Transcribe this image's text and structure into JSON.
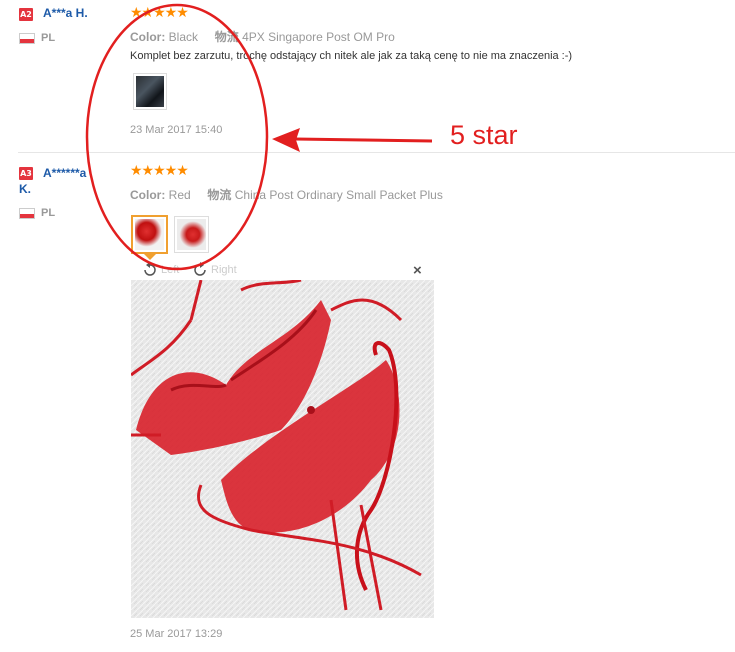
{
  "reviews": [
    {
      "badge": "A2",
      "name": "A***a H.",
      "country": "PL",
      "stars": "★★★★★",
      "color_label": "Color:",
      "color_value": "Black",
      "shipping_label": "物流",
      "shipping_value": "4PX Singapore Post OM Pro",
      "text": "Komplet bez zarzutu, trochę odstający ch nitek ale jak za taką cenę to nie ma znaczenia :-)",
      "date": "23 Mar 2017 15:40"
    },
    {
      "badge": "A3",
      "name_line1": "A******a",
      "name_line2": "K.",
      "country": "PL",
      "stars": "★★★★★",
      "color_label": "Color:",
      "color_value": "Red",
      "shipping_label": "物流",
      "shipping_value": "China Post Ordinary Small Packet Plus",
      "date": "25 Mar 2017 13:29"
    }
  ],
  "viewer": {
    "rotate_left_label": "Left",
    "rotate_right_label": "Right",
    "close_glyph": "×"
  },
  "annotation": {
    "label": "5 star"
  },
  "colors": {
    "badge": "#e4343e",
    "name": "#1d5aa8",
    "stars": "#ff8c00",
    "annotation": "#e21f1f"
  },
  "icons": [
    "flag-poland-icon",
    "rotate-left-icon",
    "rotate-right-icon",
    "close-icon",
    "star-icon"
  ]
}
